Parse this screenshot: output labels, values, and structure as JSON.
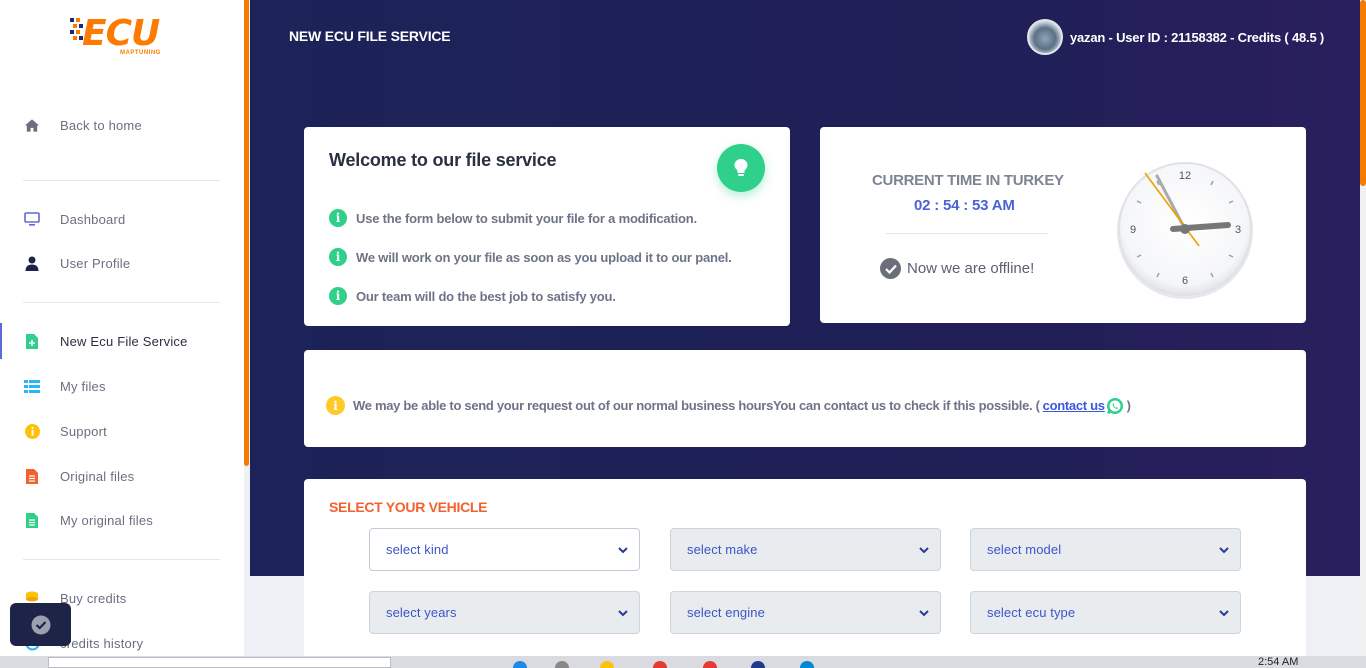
{
  "app": {
    "logo_main": "ECU",
    "logo_sub": "MAPTUNING"
  },
  "sidebar": {
    "items": [
      {
        "label": "Back to home",
        "icon": "home-icon"
      },
      {
        "label": "Dashboard",
        "icon": "monitor-icon"
      },
      {
        "label": "User Profile",
        "icon": "user-icon"
      },
      {
        "label": "New Ecu File Service",
        "icon": "file-plus-icon",
        "active": true
      },
      {
        "label": "My files",
        "icon": "list-icon"
      },
      {
        "label": "Support",
        "icon": "info-icon"
      },
      {
        "label": "Original files",
        "icon": "file-icon"
      },
      {
        "label": "My original files",
        "icon": "file-text-icon"
      },
      {
        "label": "Buy credits",
        "icon": "coins-icon"
      },
      {
        "label": "credits history",
        "icon": "history-icon"
      }
    ]
  },
  "header": {
    "page_title": "NEW ECU FILE SERVICE",
    "user_line": "yazan - User ID : 21158382 - Credits ( 48.5 )"
  },
  "welcome": {
    "title": "Welcome to our file service",
    "lines": [
      "Use the form below to submit your file for a modification.",
      "We will work on your file as soon as you upload it to our panel.",
      "Our team will do the best job to satisfy you."
    ]
  },
  "time_card": {
    "label": "CURRENT TIME IN TURKEY",
    "time": "02 : 54 : 53 AM",
    "status": "Now we are offline!",
    "clock_numbers": [
      "12",
      "3",
      "6",
      "9"
    ]
  },
  "notice": {
    "text": "We may be able to send your request out of our normal business hoursYou can contact us to check if this possible. (",
    "link": "contact us",
    "close": ")"
  },
  "vehicle": {
    "title": "SELECT YOUR VEHICLE",
    "selects": [
      "select kind",
      "select make",
      "select model",
      "select years",
      "select engine",
      "select ecu type"
    ]
  },
  "taskbar": {
    "time": "2:54 AM"
  },
  "colors": {
    "accent_orange": "#f57c00",
    "hero_navy": "#1c2358",
    "green": "#2ed08a",
    "link_blue": "#3a57e0",
    "vehicle_title": "#f2612f"
  }
}
